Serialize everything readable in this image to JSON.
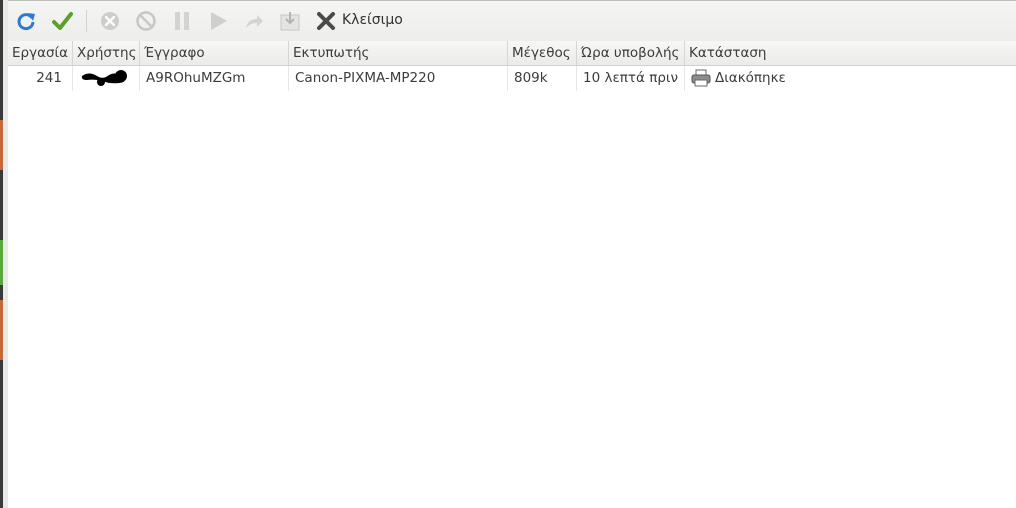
{
  "toolbar": {
    "close_label": "Κλείσιμο",
    "icons": [
      "refresh-icon",
      "check-icon",
      "cancel-icon",
      "stop-icon",
      "pause-icon",
      "play-icon",
      "redirect-icon",
      "move-icon",
      "close-icon"
    ]
  },
  "columns": [
    "Εργασία",
    "Χρήστης",
    "Έγγραφο",
    "Εκτυπωτής",
    "Μέγεθος",
    "Ώρα υποβολής",
    "Κατάσταση"
  ],
  "jobs": [
    {
      "job": "241",
      "user": "",
      "document": "A9ROhuMZGm",
      "printer": "Canon-PIXMA-MP220",
      "size": "809k",
      "submitted": "10 λεπτά πριν",
      "status": "Διακόπηκε"
    }
  ],
  "colors": {
    "toolbar_bg": "#efefed",
    "header_bg": "#f1f1ef",
    "active_icon": "#2e7ad1",
    "disabled_icon": "#c8c8c6"
  }
}
